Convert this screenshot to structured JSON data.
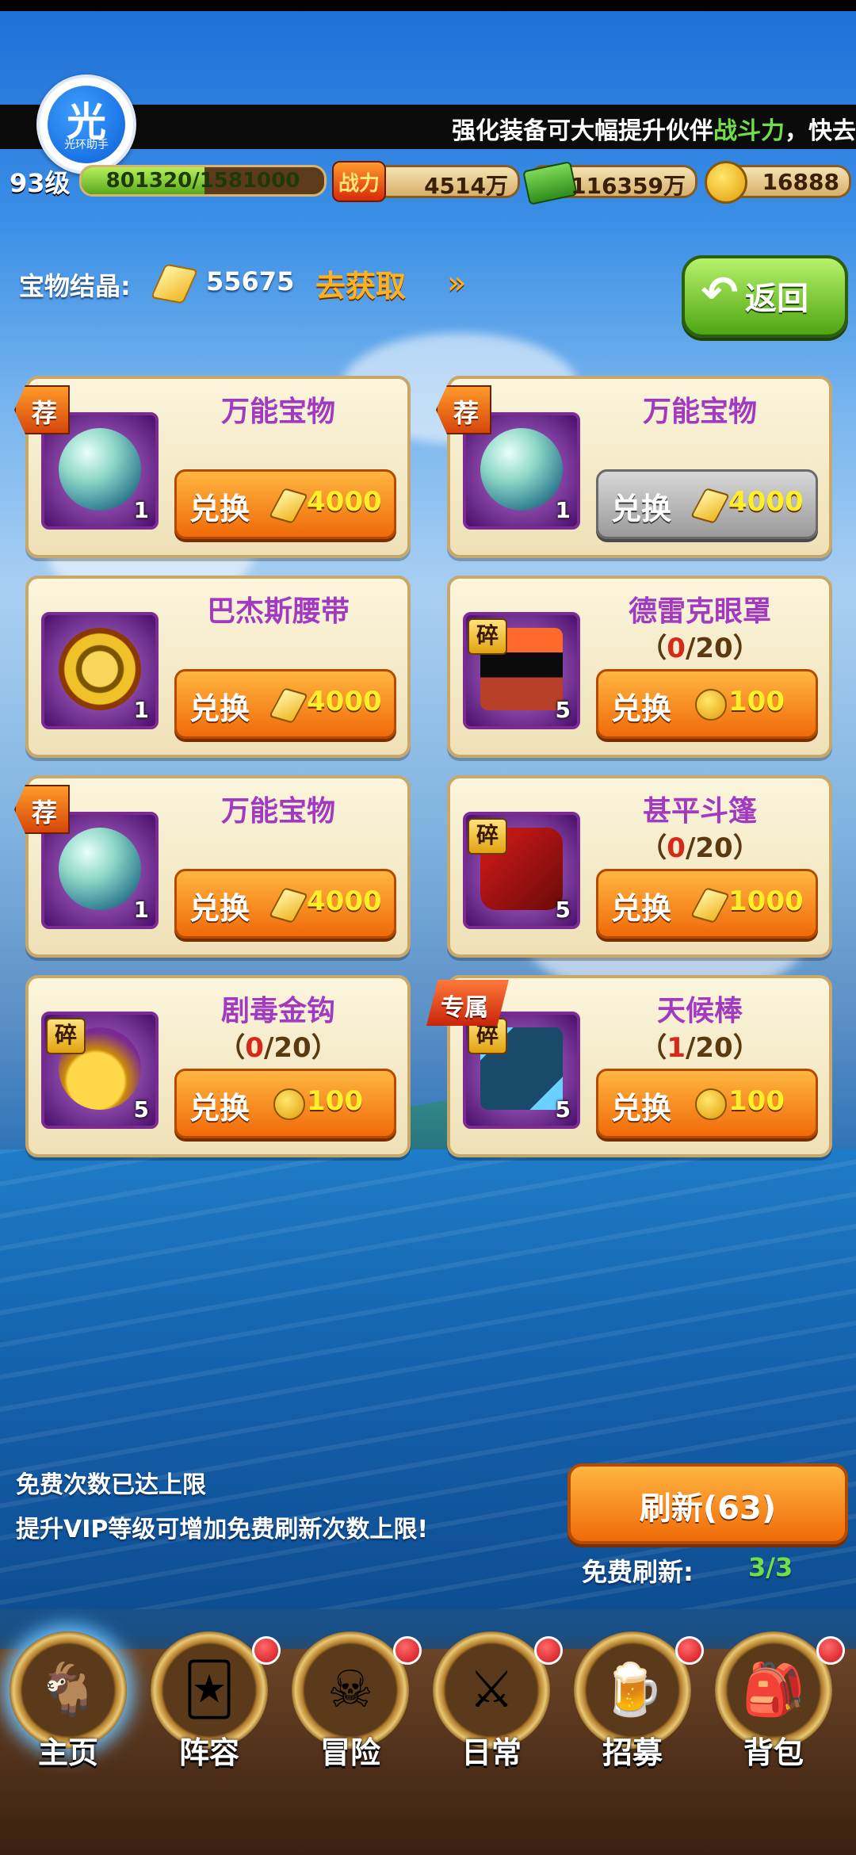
{
  "ticker": {
    "text_before": "强化装备可大幅提升伙伴",
    "text_highlight": "战斗力",
    "text_after": "，快去"
  },
  "logo": {
    "char": "光",
    "sub": "光环助手"
  },
  "stats": {
    "level": "93级",
    "exp_text": "801320/1581000",
    "exp_progress": 0.507,
    "power_icon_text": "战力",
    "power": "4514万",
    "money": "116359万",
    "coins": "16888"
  },
  "crystal": {
    "label": "宝物结晶:",
    "value": "55675",
    "get_link": "去获取"
  },
  "back_button": {
    "label": "返回"
  },
  "items": [
    {
      "name": "万能宝物",
      "count": "1",
      "badge": "荐",
      "price": "4000",
      "currency": "crystal",
      "button": "兑换",
      "disabled": false,
      "art": "orb"
    },
    {
      "name": "万能宝物",
      "count": "1",
      "badge": "荐",
      "price": "4000",
      "currency": "crystal",
      "button": "兑换",
      "disabled": true,
      "art": "orb"
    },
    {
      "name": "巴杰斯腰带",
      "count": "1",
      "price": "4000",
      "currency": "crystal",
      "button": "兑换",
      "disabled": false,
      "art": "belt"
    },
    {
      "name": "德雷克眼罩",
      "count": "5",
      "fragment": "碎",
      "progress_open": "（",
      "progress_cur": "0",
      "progress_total": "/20",
      "progress_close": "）",
      "price": "100",
      "currency": "coin",
      "button": "兑换",
      "disabled": false,
      "art": "blindfold"
    },
    {
      "name": "万能宝物",
      "count": "1",
      "badge": "荐",
      "price": "4000",
      "currency": "crystal",
      "button": "兑换",
      "disabled": false,
      "art": "orb"
    },
    {
      "name": "甚平斗篷",
      "count": "5",
      "fragment": "碎",
      "progress_open": "（",
      "progress_cur": "0",
      "progress_total": "/20",
      "progress_close": "）",
      "price": "1000",
      "currency": "crystal",
      "button": "兑换",
      "disabled": false,
      "art": "cape"
    },
    {
      "name": "剧毒金钩",
      "count": "5",
      "fragment": "碎",
      "progress_open": "（",
      "progress_cur": "0",
      "progress_total": "/20",
      "progress_close": "）",
      "price": "100",
      "currency": "coin",
      "button": "兑换",
      "disabled": false,
      "art": "hook"
    },
    {
      "name": "天候棒",
      "count": "5",
      "fragment": "碎",
      "exclusive": "专属",
      "progress_open": "（",
      "progress_cur": "1",
      "progress_total": "/20",
      "progress_close": "）",
      "price": "100",
      "currency": "coin",
      "button": "兑换",
      "disabled": false,
      "art": "staff"
    }
  ],
  "notice": {
    "line1": "免费次数已达上限",
    "line2": "提升VIP等级可增加免费刷新次数上限!"
  },
  "refresh": {
    "label": "刷新(63)",
    "free_label": "免费刷新:",
    "free_value": "3/3"
  },
  "nav": [
    {
      "label": "主页",
      "icon": "home-icon",
      "active": true,
      "dot": false
    },
    {
      "label": "阵容",
      "icon": "lineup-icon",
      "active": false,
      "dot": true
    },
    {
      "label": "冒险",
      "icon": "adventure-icon",
      "active": false,
      "dot": true
    },
    {
      "label": "日常",
      "icon": "daily-icon",
      "active": false,
      "dot": true
    },
    {
      "label": "招募",
      "icon": "recruit-icon",
      "active": false,
      "dot": true
    },
    {
      "label": "背包",
      "icon": "backpack-icon",
      "active": false,
      "dot": true
    }
  ]
}
